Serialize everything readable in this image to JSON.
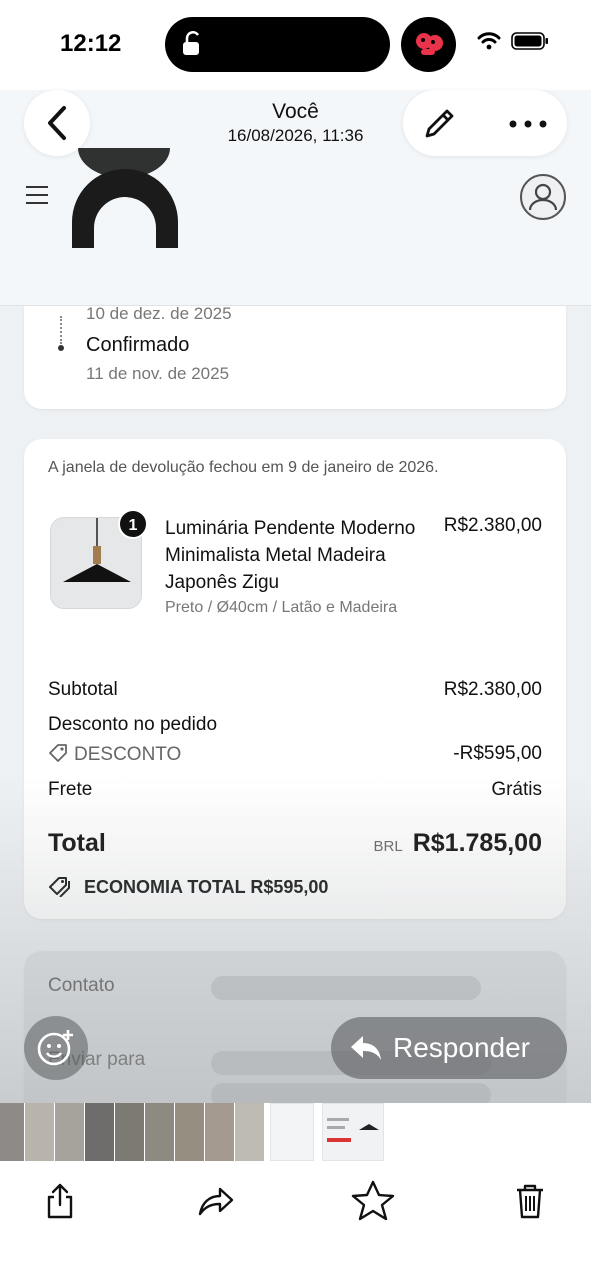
{
  "status_bar": {
    "time": "12:12"
  },
  "header": {
    "sender": "Você",
    "datetime": "16/08/2026, 11:36"
  },
  "timeline": {
    "previous_date": "10 de dez. de 2025",
    "label": "Confirmado",
    "date": "11 de nov. de 2025"
  },
  "order": {
    "return_note": "A janela de devolução fechou em 9 de janeiro de 2026.",
    "product": {
      "quantity": "1",
      "name": "Luminária Pendente Moderno Minimalista Metal Madeira Japonês Zigu",
      "price": "R$2.380,00",
      "variant": "Preto / Ø40cm / Latão e Madeira"
    },
    "subtotal_label": "Subtotal",
    "subtotal_value": "R$2.380,00",
    "discount_label": "Desconto no pedido",
    "discount_code": "DESCONTO",
    "discount_value": "-R$595,00",
    "shipping_label": "Frete",
    "shipping_value": "Grátis",
    "total_label": "Total",
    "total_currency": "BRL",
    "total_value": "R$1.785,00",
    "savings": "ECONOMIA TOTAL R$595,00"
  },
  "contact": {
    "contact_label": "Contato",
    "ship_label": "Enviar para"
  },
  "actions": {
    "reply_label": "Responder"
  },
  "icons": [
    "lock-icon",
    "app-icon",
    "wifi-icon",
    "battery-icon",
    "back-icon",
    "edit-icon",
    "more-icon",
    "menu-icon",
    "account-icon",
    "tag-icon",
    "emoji-icon",
    "reply-icon",
    "share-icon",
    "forward-icon",
    "star-icon",
    "trash-icon"
  ],
  "colors": {
    "accent_red": "#e8334a",
    "card_bg": "#ffffff",
    "page_bg": "#eef1f3"
  }
}
